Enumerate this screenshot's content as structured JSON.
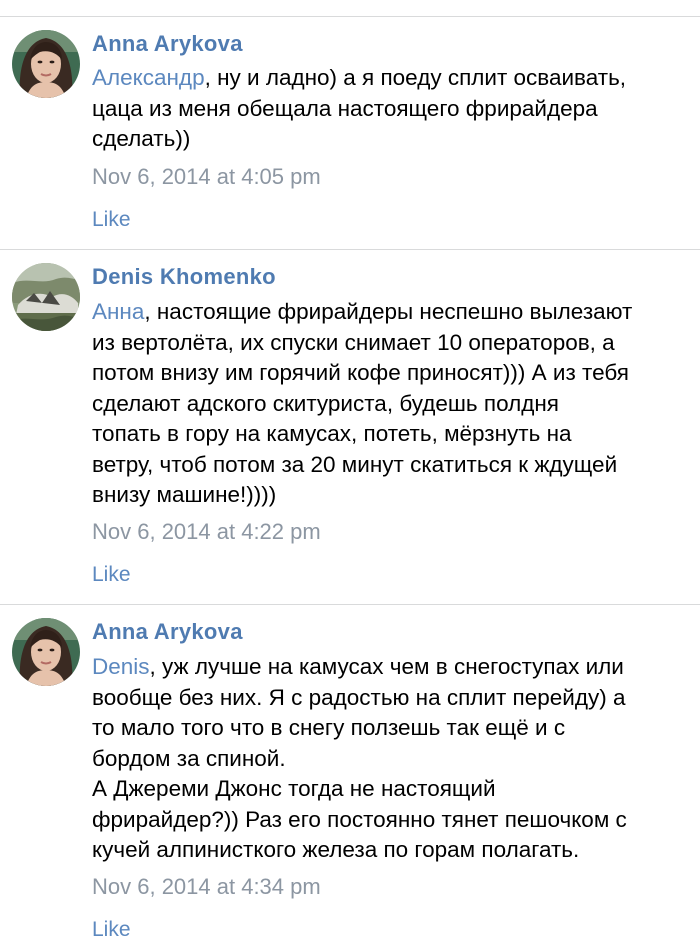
{
  "comments": [
    {
      "author": "Anna Arykova",
      "avatar": "anna-avatar",
      "mention": "Александр",
      "lines": [
        ", ну и ладно) а я поеду сплит осваивать,",
        "цаца из меня обещала настоящего фрирайдера",
        "сделать))"
      ],
      "date": "Nov 6, 2014 at 4:05 pm",
      "like": "Like"
    },
    {
      "author": "Denis Khomenko",
      "avatar": "denis-avatar",
      "mention": "Анна",
      "lines": [
        ", настоящие фрирайдеры неспешно вылезают",
        "из вертолёта, их спуски снимает 10 операторов, а",
        "потом внизу им горячий кофе приносят))) А из тебя",
        "сделают адского скитуриста, будешь полдня",
        "топать в гору на камусах, потеть, мёрзнуть на",
        "ветру, чтоб потом за 20 минут скатиться к ждущей",
        "внизу машине!))))"
      ],
      "date": "Nov 6, 2014 at 4:22 pm",
      "like": "Like"
    },
    {
      "author": "Anna Arykova",
      "avatar": "anna-avatar",
      "mention": "Denis",
      "lines": [
        ", уж лучше на камусах чем в снегоступах или",
        "вообще без них. Я с радостью на сплит перейду) а",
        "то мало того что в снегу ползешь так ещё и с",
        "бордом за спиной.",
        "А Джереми Джонс тогда не настоящий",
        "фрирайдер?)) Раз его постоянно тянет пешочком с",
        "кучей алпинисткого железа по горам полагать."
      ],
      "date": "Nov 6, 2014 at 4:34 pm",
      "like": "Like"
    }
  ]
}
